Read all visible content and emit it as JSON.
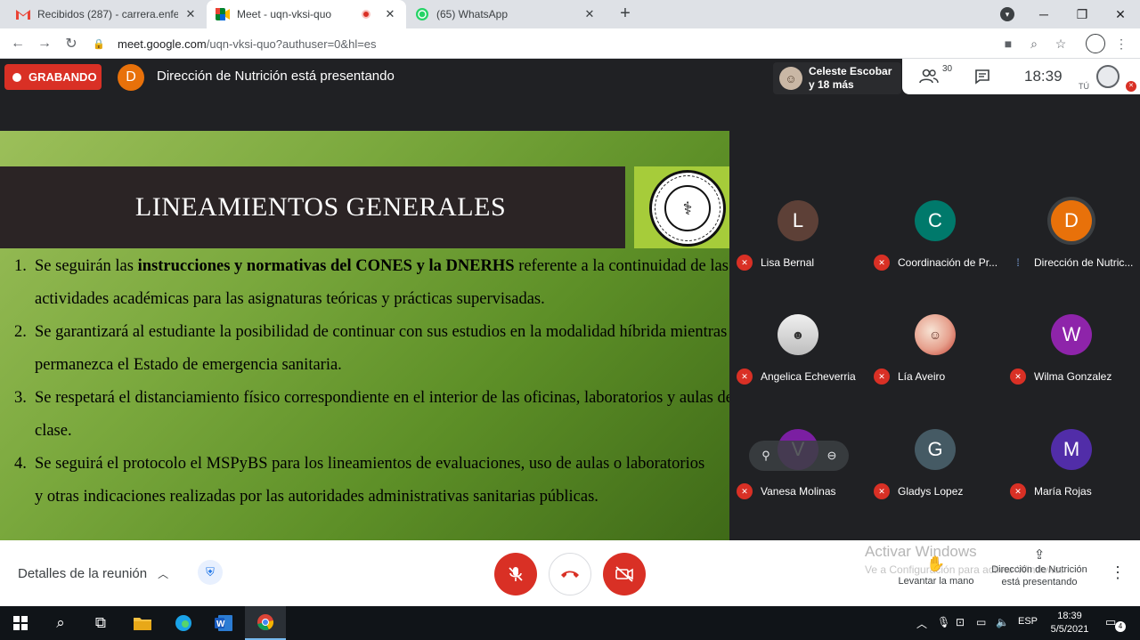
{
  "browser": {
    "tabs": [
      {
        "title": "Recibidos (287) - carrera.enferme",
        "icon": "gmail-icon",
        "active": false
      },
      {
        "title": "Meet - uqn-vksi-quo",
        "icon": "meet-icon",
        "active": true
      },
      {
        "title": "(65) WhatsApp",
        "icon": "whatsapp-icon",
        "active": false
      }
    ],
    "close_glyph": "✕",
    "newtab_glyph": "+",
    "url_host": "meet.google.com",
    "url_path": "/uqn-vksi-quo?authuser=0&hl=es"
  },
  "meet": {
    "recording_label": "GRABANDO",
    "presenter_initial": "D",
    "presenting_text": "Dirección de Nutrición está presentando",
    "people_chip": {
      "line1": "Celeste Escobar",
      "line2": "y 18 más"
    },
    "participant_count": "30",
    "clock": "18:39",
    "self_label": "TÚ"
  },
  "slide": {
    "title": "LINEAMIENTOS GENERALES",
    "items": [
      {
        "num": "1.",
        "pre": "Se seguirán las ",
        "bold": "instrucciones y normativas del CONES y la DNERHS",
        "post": " referente a la continuidad de las actividades académicas para las asignaturas teóricas y prácticas supervisadas."
      },
      {
        "num": "2.",
        "pre": "Se garantizará al estudiante la posibilidad de continuar con sus estudios en la modalidad híbrida mientras permanezca el Estado de emergencia sanitaria.",
        "bold": "",
        "post": ""
      },
      {
        "num": "3.",
        "pre": "Se respetará el distanciamiento físico correspondiente en el interior de las oficinas, laboratorios y aulas de clase.",
        "bold": "",
        "post": ""
      },
      {
        "num": "4.",
        "pre": "Se seguirá el protocolo el MSPyBS para los lineamientos de evaluaciones, uso de aulas o laboratorios y otras indicaciones realizadas por las autoridades administrativas sanitarias públicas.",
        "bold": "",
        "post": ""
      }
    ]
  },
  "participants": [
    {
      "name": "Lisa Bernal",
      "initial": "L",
      "color": "#5d4037",
      "muted": true
    },
    {
      "name": "Coordinación de Pr...",
      "initial": "C",
      "color": "#00796b",
      "muted": true
    },
    {
      "name": "Dirección de Nutric...",
      "initial": "D",
      "color": "#e8710a",
      "muted": false
    },
    {
      "name": "Angelica Echeverria",
      "initial": "",
      "color": "#d5d5d5",
      "muted": true
    },
    {
      "name": "Lía Aveiro",
      "initial": "",
      "color": "#f5d7d0",
      "muted": true
    },
    {
      "name": "Wilma Gonzalez",
      "initial": "W",
      "color": "#8e24aa",
      "muted": true
    },
    {
      "name": "Vanesa Molinas",
      "initial": "V",
      "color": "#7b1fa2",
      "muted": true
    },
    {
      "name": "Gladys Lopez",
      "initial": "G",
      "color": "#455a64",
      "muted": true
    },
    {
      "name": "María Rojas",
      "initial": "M",
      "color": "#512da8",
      "muted": true
    }
  ],
  "controls": {
    "details_label": "Detalles de la reunión",
    "raise_hand_label": "Levantar la mano",
    "presenting_line1": "Dirección de Nutrición",
    "presenting_line2": "está presentando",
    "activate_windows_title": "Activar Windows",
    "activate_windows_sub": "Ve a Configuración para activar Windows."
  },
  "taskbar": {
    "lang": "ESP",
    "time": "18:39",
    "date": "5/5/2021",
    "notifications": "4"
  },
  "colors": {
    "recording": "#d93025",
    "slide_green": "#7aa83d",
    "title_band": "#2b2425"
  }
}
